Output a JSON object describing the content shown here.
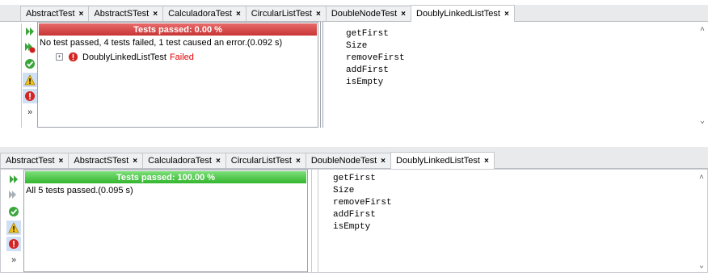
{
  "top": {
    "tabs": [
      {
        "label": "AbstractTest"
      },
      {
        "label": "AbstractSTest"
      },
      {
        "label": "CalculadoraTest"
      },
      {
        "label": "CircularListTest"
      },
      {
        "label": "DoubleNodeTest"
      },
      {
        "label": "DoublyLinkedListTest"
      }
    ],
    "close_symbol": "×",
    "progress": {
      "label": "Tests passed: 0.00 %",
      "percent": 0,
      "color": "#d04040"
    },
    "summary": "No test passed, 4 tests failed, 1 test caused an error.(0.092 s)",
    "tree": {
      "expander": "+",
      "name": "DoublyLinkedListTest",
      "status": "Failed"
    },
    "output_lines": [
      "getFirst",
      "Size",
      "removeFirst",
      "addFirst",
      "isEmpty"
    ],
    "more": "»"
  },
  "bottom": {
    "tabs": [
      {
        "label": "AbstractTest"
      },
      {
        "label": "AbstractSTest"
      },
      {
        "label": "CalculadoraTest"
      },
      {
        "label": "CircularListTest"
      },
      {
        "label": "DoubleNodeTest"
      },
      {
        "label": "DoublyLinkedListTest"
      }
    ],
    "close_symbol": "×",
    "progress": {
      "label": "Tests passed: 100.00 %",
      "percent": 100,
      "color": "#3cc039"
    },
    "summary": "All 5 tests passed.(0.095 s)",
    "output_lines": [
      "getFirst",
      "Size",
      "removeFirst",
      "addFirst",
      "isEmpty"
    ],
    "more": "»"
  },
  "icons": {
    "rerun": "rerun-icon",
    "rerun_failed": "rerun-failed-icon",
    "passed_filter": "passed-check-icon",
    "warning_filter": "warning-icon",
    "error_filter": "error-icon",
    "failed": "error-icon"
  }
}
